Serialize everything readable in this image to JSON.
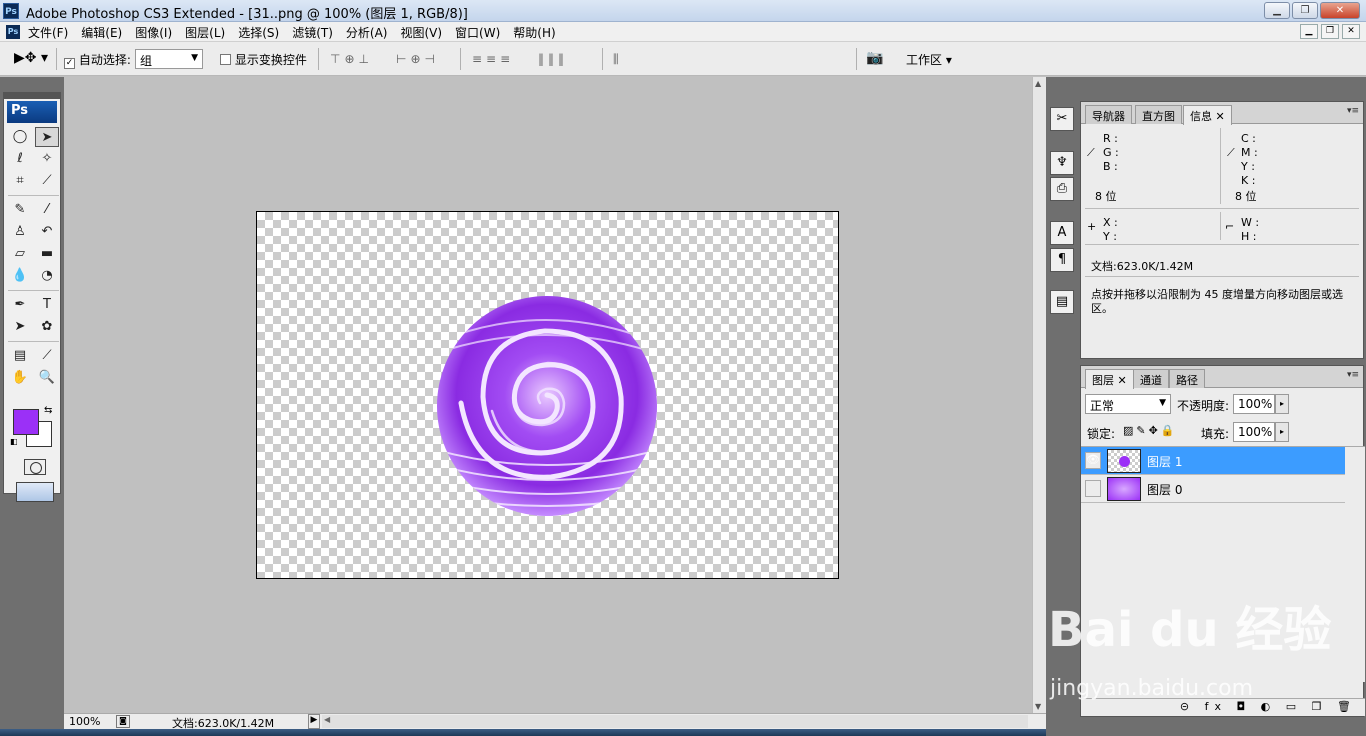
{
  "window": {
    "title": "Adobe Photoshop CS3 Extended - [31..png @ 100% (图层 1, RGB/8)]",
    "logo": "Ps",
    "min": "▁",
    "max": "❐",
    "close": "✕"
  },
  "menu": [
    "文件(F)",
    "编辑(E)",
    "图像(I)",
    "图层(L)",
    "选择(S)",
    "滤镜(T)",
    "分析(A)",
    "视图(V)",
    "窗口(W)",
    "帮助(H)"
  ],
  "options": {
    "auto_select_label": "自动选择:",
    "auto_select_checked": "✓",
    "auto_select_value": "组",
    "show_transform_label": "显示变换控件",
    "align_group1": "⊤⊕⊥",
    "align_group2": "⊢⊕⊣",
    "distribute_group1": "≡≡≡",
    "distribute_group2": "‖‖‖",
    "auto_align": "⫼",
    "workspace_label": "工作区 ▾"
  },
  "toolbox": {
    "logo": "Ps",
    "fg_color": "#9b30f7",
    "bg_color": "#ffffff"
  },
  "status": {
    "zoom": "100%",
    "doc_info": "文档:623.0K/1.42M"
  },
  "info_panel": {
    "tabs": [
      "导航器",
      "直方图",
      "信息"
    ],
    "active_tab": "信息",
    "rgb": [
      "R :",
      "G :",
      "B :"
    ],
    "cmyk": [
      "C :",
      "M :",
      "Y :",
      "K :"
    ],
    "bits_left": "8 位",
    "bits_right": "8 位",
    "xy": [
      "X :",
      "Y :"
    ],
    "wh": [
      "W :",
      "H :"
    ],
    "doc": "文档:623.0K/1.42M",
    "hint": "点按并拖移以沿限制为 45 度增量方向移动图层或选区。"
  },
  "layers_panel": {
    "tabs": [
      "图层",
      "通道",
      "路径"
    ],
    "active_tab": "图层",
    "blend_mode": "正常",
    "opacity_label": "不透明度:",
    "opacity": "100%",
    "lock_label": "锁定:",
    "fill_label": "填充:",
    "fill": "100%",
    "layers": [
      {
        "name": "图层 1",
        "visible": true,
        "selected": true
      },
      {
        "name": "图层 0",
        "visible": false,
        "selected": false
      }
    ],
    "bottom_icons": "⊝ fx ◘ ◐ ▭ ❒ 🗑"
  },
  "watermark": {
    "brand": "Bai du 经验",
    "url": "jingyan.baidu.com"
  }
}
